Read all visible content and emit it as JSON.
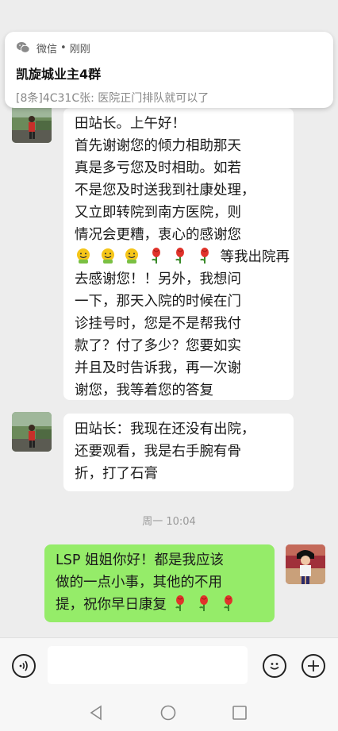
{
  "notification": {
    "app": "微信",
    "separator": "•",
    "time": "刚刚",
    "title": "凯旋城业主4群",
    "preview": "[8条]4C31C张: 医院正门排队就可以了"
  },
  "messages": [
    {
      "side": "left",
      "lines": [
        "田站长。上午好！",
        "首先谢谢您的倾力相助那天",
        "真是多亏您及时相助。如若",
        "不是您及时送我到社康处理，",
        "又立即转院到南方医院，则",
        "情况会更糟，衷心的感谢您",
        "等我出院再",
        "去感谢您！！另外，我想问",
        "一下，那天入院的时候在门",
        "诊挂号时，您是不是帮我付",
        "款了？付了多少？您要如实",
        "并且及时告诉我，再一次谢",
        "谢您，我等着您的答复"
      ],
      "emoji_line_index": 6,
      "emojis": [
        "smile-emoji",
        "smile-emoji",
        "smile-emoji",
        "rose-emoji",
        "rose-emoji",
        "rose-emoji"
      ]
    },
    {
      "side": "left",
      "lines": [
        "田站长：我现在还没有出院，",
        "还要观看，我是右手腕有骨",
        "折，打了石膏"
      ]
    },
    {
      "side": "right",
      "lines": [
        "LSP 姐姐你好！都是我应该",
        "做的一点小事，其他的不用",
        "提，祝你早日康复"
      ],
      "emoji_line_index": 2,
      "emojis": [
        "rose-emoji",
        "rose-emoji",
        "rose-emoji"
      ]
    }
  ],
  "timestamp": "周一 10:04",
  "input": {
    "value": "",
    "placeholder": ""
  },
  "icons": {
    "voice": "voice-icon",
    "emoji": "emoji-icon",
    "add": "plus-icon",
    "back": "back-triangle-icon",
    "home": "home-circle-icon",
    "recents": "recents-square-icon"
  },
  "colors": {
    "background": "#ededed",
    "own_bubble": "#95ec69",
    "other_bubble": "#ffffff"
  }
}
